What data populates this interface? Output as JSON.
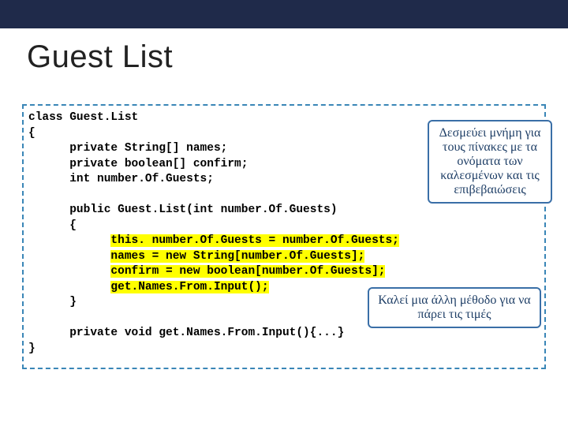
{
  "title": "Guest List",
  "code": {
    "l1": "class Guest.List",
    "l2": "{",
    "l3": "      private String[] names;",
    "l4": "      private boolean[] confirm;",
    "l5": "      int number.Of.Guests;",
    "l6": "",
    "l7": "      public Guest.List(int number.Of.Guests)",
    "l8": "      {",
    "l9a": "            ",
    "l9b": "this. number.Of.Guests = number.Of.Guests;",
    "l10a": "            ",
    "l10b": "names = new String[number.Of.Guests];",
    "l11a": "            ",
    "l11b": "confirm = new boolean[number.Of.Guests];",
    "l12a": "            ",
    "l12b": "get.Names.From.Input();",
    "l13": "      }",
    "l14": "",
    "l15": "      private void get.Names.From.Input(){...}",
    "l16": "}"
  },
  "callout1": "Δεσμεύει μνήμη για τους πίνακες με τα ονόματα των καλεσμένων και τις επιβεβαιώσεις",
  "callout2": "Καλεί μια άλλη μέθοδο για να πάρει τις τιμές"
}
